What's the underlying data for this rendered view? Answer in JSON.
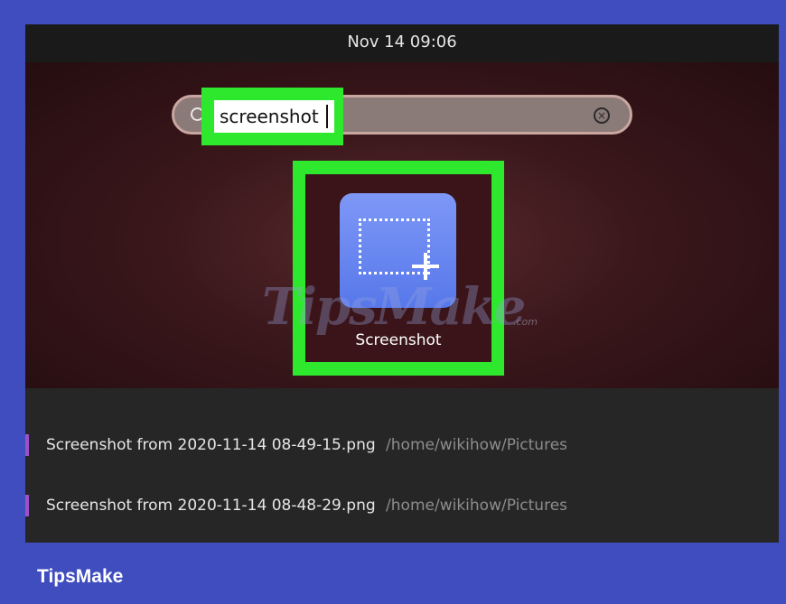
{
  "topbar": {
    "clock": "Nov 14  09:06"
  },
  "search": {
    "value": "screenshot",
    "placeholder": "",
    "icon": "search-icon",
    "clear_icon": "close-circle-icon"
  },
  "app_result": {
    "label": "Screenshot",
    "icon": "screenshot-app-icon",
    "icon_color": "#6a88f2"
  },
  "highlight_color": "#2ee82e",
  "watermark": {
    "text": "TipsMake",
    "suffix": ".com"
  },
  "file_results": [
    {
      "name": "Screenshot from 2020-11-14 08-49-15.png",
      "path": "/home/wikihow/Pictures"
    },
    {
      "name": "Screenshot from 2020-11-14 08-48-29.png",
      "path": "/home/wikihow/Pictures"
    }
  ],
  "brand": {
    "label": "TipsMake",
    "background": "#3f4dbf"
  }
}
